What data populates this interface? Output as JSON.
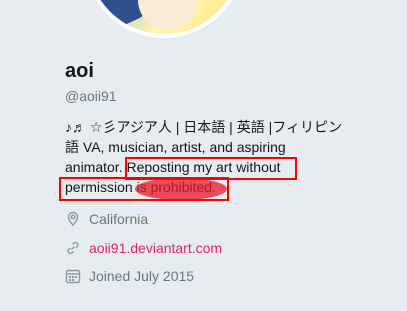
{
  "profile": {
    "name": "aoi",
    "handle": "@aoii91",
    "bio_line1": "♪♬ ☆彡アジア人 | 日本語 | 英語 |フィリピン",
    "bio_line2": "語 VA, musician, artist, and aspiring",
    "bio_line3_pre": "animator. ",
    "bio_line3_highlight": "Reposting my art without",
    "bio_line4": "permission is prohibited.",
    "location": "California",
    "website": "aoii91.deviantart.com",
    "joined": "Joined July 2015"
  },
  "icons": {
    "location": "location-pin-icon",
    "website": "link-icon",
    "joined": "calendar-icon"
  },
  "colors": {
    "background": "#e6ecf0",
    "link": "#e0245e",
    "annotation": "#ff0000",
    "muted": "#657786"
  }
}
